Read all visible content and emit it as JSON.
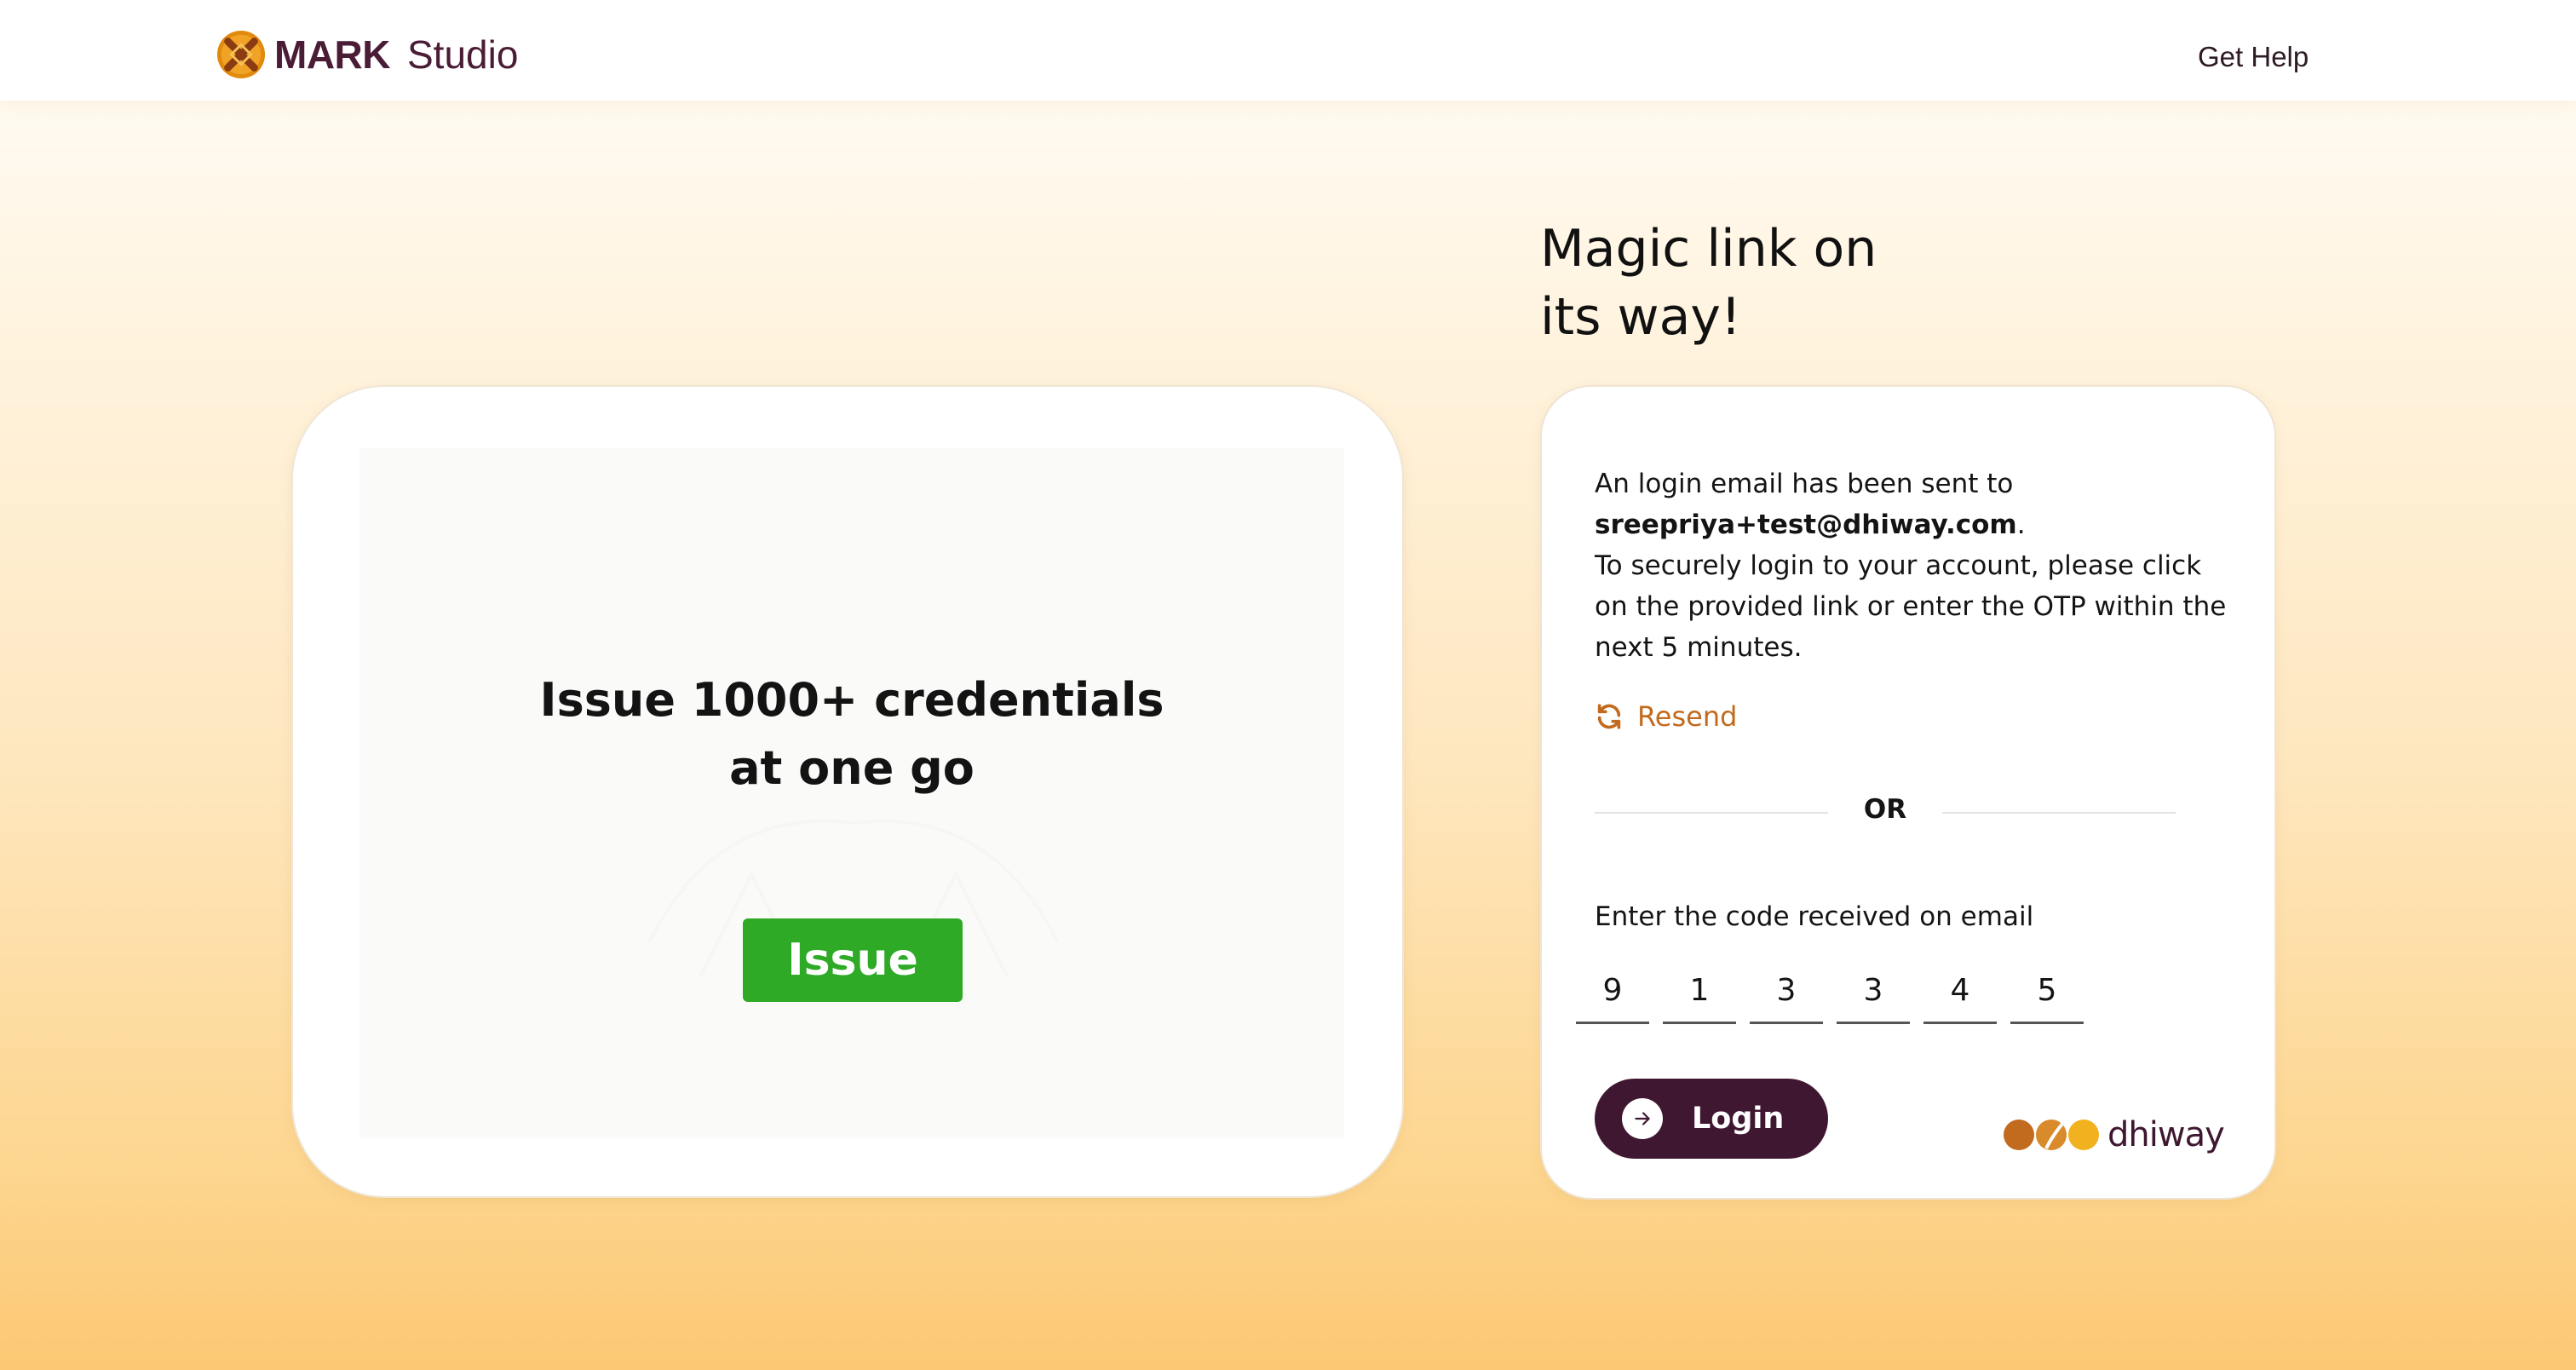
{
  "header": {
    "logo_bold": "MARK",
    "logo_regular": "Studio",
    "help_label": "Get Help"
  },
  "promo": {
    "title_line1": "Issue 1000+ credentials",
    "title_line2": "at one go",
    "button_label": "Issue",
    "button_color": "#2eaa27"
  },
  "login": {
    "heading_line1": "Magic link on",
    "heading_line2": "its way!",
    "message_prefix": "An login email has been sent to",
    "email": "sreepriya+test@dhiway.com",
    "email_suffix": ".",
    "message_body": "To securely login to your account, please click on the provided link or enter the OTP within the next 5 minutes.",
    "resend_label": "Resend",
    "resend_icon": "refresh-icon",
    "or_label": "OR",
    "code_label": "Enter the code received on email",
    "otp": [
      "9",
      "1",
      "3",
      "3",
      "4",
      "5"
    ],
    "login_label": "Login",
    "login_icon": "arrow-right-icon",
    "brand_text": "dhiway"
  },
  "colors": {
    "accent": "#3f1731",
    "resend": "#c26a1d",
    "brand_dot1": "#c26a1d",
    "brand_dot3": "#f2b11f"
  }
}
